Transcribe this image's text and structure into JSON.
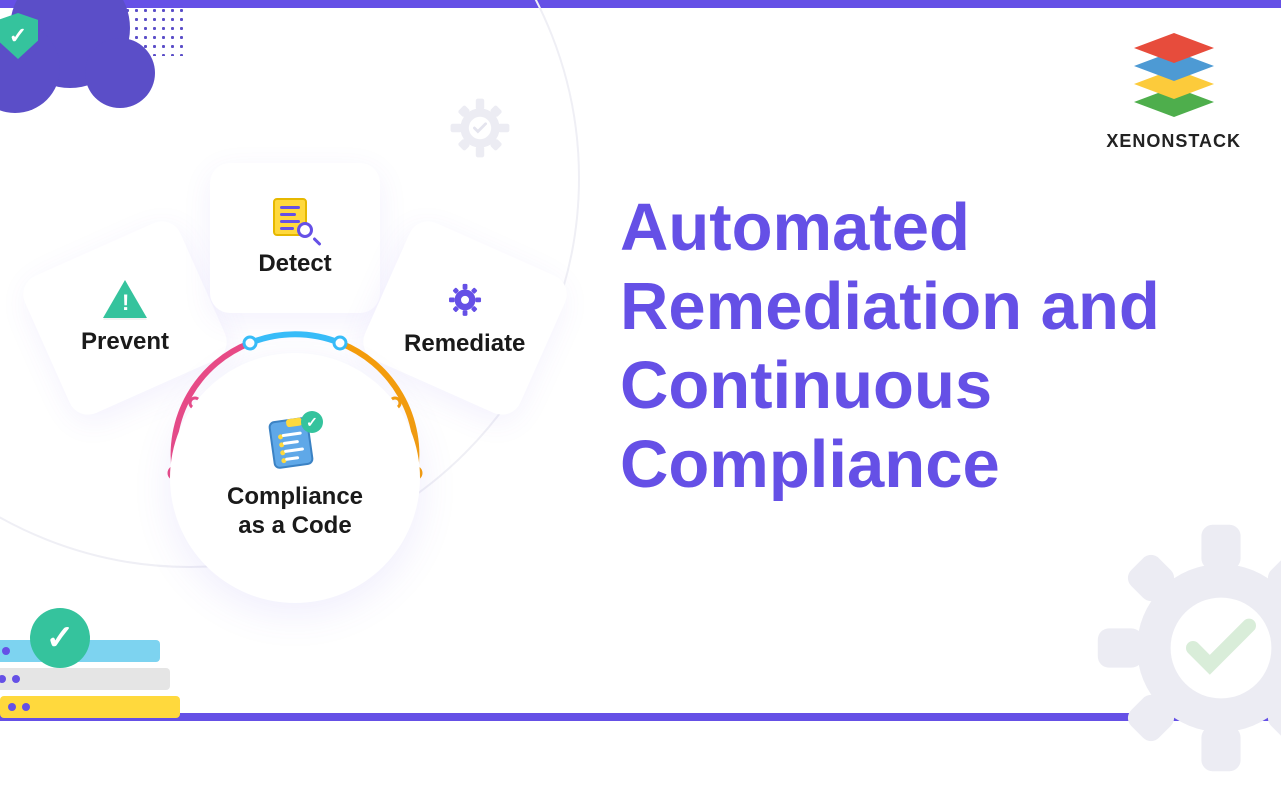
{
  "brand": {
    "name": "XENONSTACK"
  },
  "title": "Automated Remediation and Continuous Compliance",
  "diagram": {
    "prevent": {
      "label": "Prevent",
      "icon": "warning-triangle-icon"
    },
    "detect": {
      "label": "Detect",
      "icon": "search-list-icon"
    },
    "remediate": {
      "label": "Remediate",
      "icon": "gear-icon"
    },
    "center": {
      "line1": "Compliance",
      "line2": "as a Code",
      "icon": "checklist-icon"
    }
  },
  "colors": {
    "primary": "#6550E6",
    "teal": "#35C39D",
    "yellow": "#FFD93D",
    "pink": "#E94B86",
    "blue": "#38BDF8",
    "orange": "#F59E0B"
  }
}
